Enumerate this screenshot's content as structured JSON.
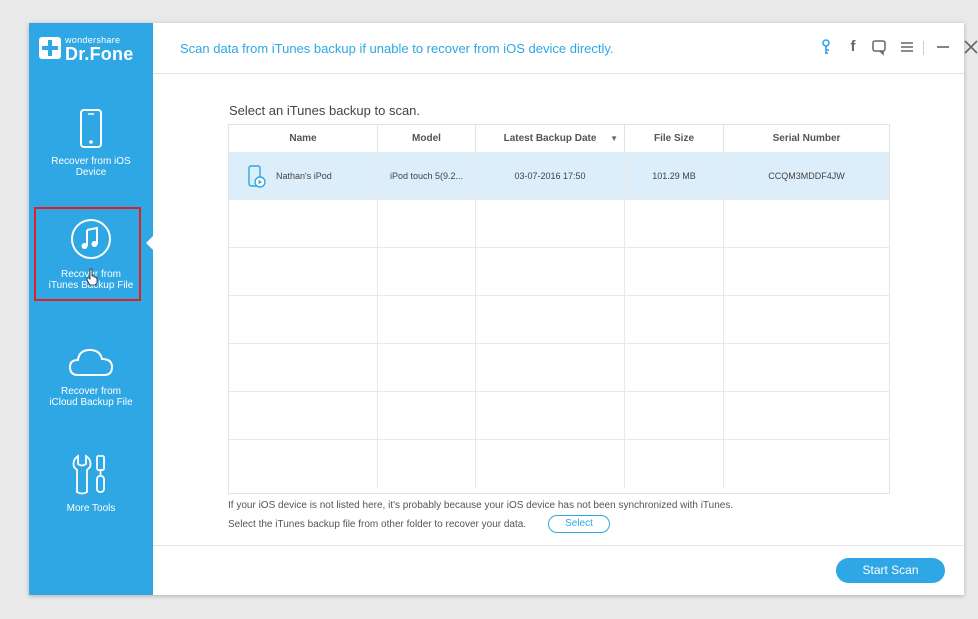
{
  "app": {
    "brand_small": "wondershare",
    "brand_name": "Dr.Fone"
  },
  "header": {
    "message": "Scan data from iTunes backup if unable to recover from iOS device directly.",
    "icons": [
      "key-icon",
      "facebook-icon",
      "feedback-icon",
      "menu-icon",
      "minimize-icon",
      "close-icon"
    ]
  },
  "sidebar": {
    "items": [
      {
        "label_line1": "Recover from iOS",
        "label_line2": "Device",
        "icon": "phone-icon"
      },
      {
        "label_line1": "Recover from",
        "label_line2": "iTunes Backup File",
        "icon": "music-note-icon",
        "active": true
      },
      {
        "label_line1": "Recover from",
        "label_line2": "iCloud Backup File",
        "icon": "cloud-icon"
      },
      {
        "label_line1": "More Tools",
        "label_line2": "",
        "icon": "tools-icon"
      }
    ]
  },
  "main": {
    "title": "Select an iTunes backup to scan.",
    "table": {
      "columns": [
        "Name",
        "Model",
        "Latest Backup Date",
        "File Size",
        "Serial Number"
      ],
      "rows": [
        {
          "name": "Nathan's iPod",
          "model": "iPod touch 5(9.2...",
          "date": "03-07-2016 17:50",
          "size": "101.29 MB",
          "serial": "CCQM3MDDF4JW"
        }
      ]
    },
    "note_line1": "If your iOS device is not listed here, it's probably because your iOS device has not been synchronized with iTunes.",
    "note_line2": "Select the iTunes backup file from other folder to recover your data.",
    "select_label": "Select",
    "start_label": "Start Scan"
  },
  "colors": {
    "accent": "#2ea7e4",
    "selected_row": "#dbeef9",
    "highlight_box": "#e02020"
  }
}
